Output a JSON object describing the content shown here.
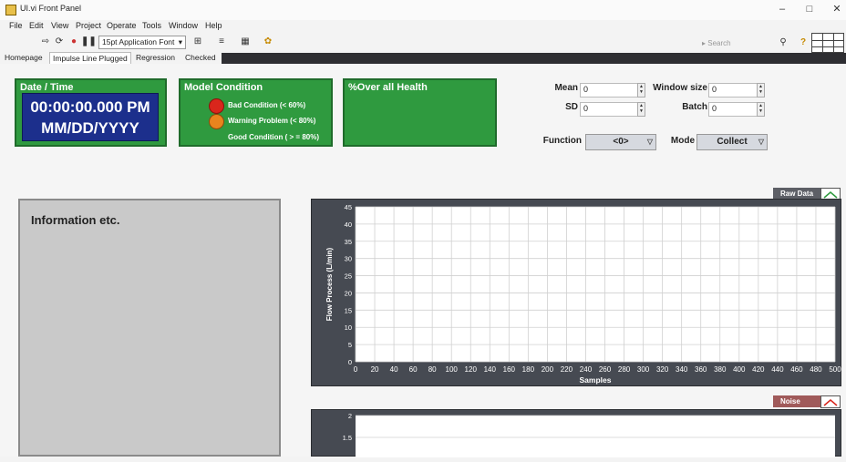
{
  "window": {
    "title": "UI.vi Front Panel"
  },
  "menu": [
    "File",
    "Edit",
    "View",
    "Project",
    "Operate",
    "Tools",
    "Window",
    "Help"
  ],
  "toolbar": {
    "font": "15pt Application Font",
    "search_placeholder": "Search"
  },
  "tabs": [
    "Homepage",
    "Impulse Line Plugged",
    "Regression",
    "Checked"
  ],
  "datetime": {
    "title": "Date / Time",
    "time": "00:00:00.000 PM",
    "date": "MM/DD/YYYY"
  },
  "condition": {
    "title": "Model Condition",
    "bad": "Bad Condition (< 60%)",
    "warning": "Warning Problem (< 80%)",
    "good": "Good Condition ( > = 80%)",
    "colors": {
      "bad": "#d9261c",
      "warning": "#e8841e"
    }
  },
  "health": {
    "title": "%Over all Health"
  },
  "controls": {
    "mean_label": "Mean",
    "mean_value": "0",
    "sd_label": "SD",
    "sd_value": "0",
    "window_label": "Window size",
    "window_value": "0",
    "batch_label": "Batch",
    "batch_value": "0",
    "function_label": "Function",
    "function_value": "<0>",
    "mode_label": "Mode",
    "mode_value": "Collect"
  },
  "info": {
    "title": "Information etc."
  },
  "graph1": {
    "legend": "Raw Data",
    "ylabel": "Flow Process (L/min)",
    "xlabel": "Samples"
  },
  "graph2": {
    "legend": "Noise"
  },
  "chart_data": [
    {
      "type": "line",
      "title": "",
      "xlabel": "Samples",
      "ylabel": "Flow Process (L/min)",
      "xlim": [
        0,
        500
      ],
      "ylim": [
        0,
        45
      ],
      "x_ticks": [
        0,
        20,
        40,
        60,
        80,
        100,
        120,
        140,
        160,
        180,
        200,
        220,
        240,
        260,
        280,
        300,
        320,
        340,
        360,
        380,
        400,
        420,
        440,
        460,
        480,
        500
      ],
      "y_ticks": [
        0,
        5,
        10,
        15,
        20,
        25,
        30,
        35,
        40,
        45
      ],
      "series": [
        {
          "name": "Raw Data",
          "values": []
        }
      ],
      "grid": true
    },
    {
      "type": "line",
      "title": "",
      "y_ticks": [
        1.5,
        2
      ],
      "series": [
        {
          "name": "Noise",
          "values": []
        }
      ],
      "grid": true
    }
  ]
}
